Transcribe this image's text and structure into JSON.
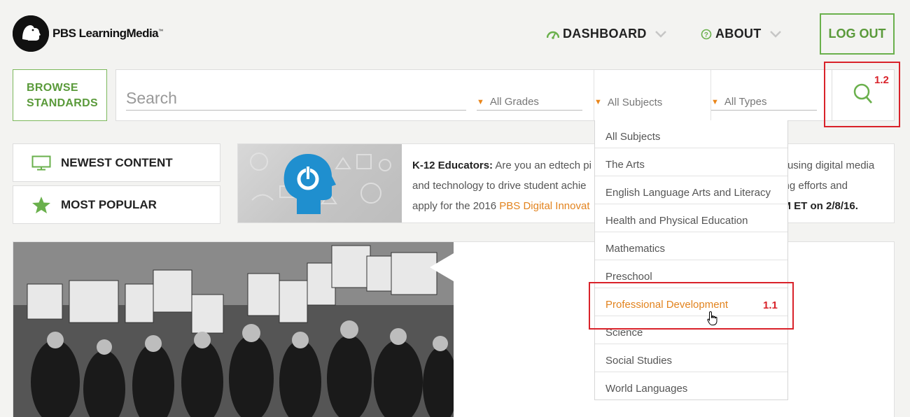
{
  "brand": {
    "name": "PBS LearningMedia",
    "trademark": "™"
  },
  "nav": {
    "dashboard": "DASHBOARD",
    "about": "ABOUT",
    "logout": "LOG OUT"
  },
  "search": {
    "browse_line1": "BROWSE",
    "browse_line2": "STANDARDS",
    "placeholder": "Search",
    "grades": "All Grades",
    "subjects": "All Subjects",
    "types": "All Types"
  },
  "annotations": {
    "search": "1.2",
    "dropdown": "1.1"
  },
  "sidebar": {
    "newest": "NEWEST CONTENT",
    "popular": "MOST POPULAR"
  },
  "promo": {
    "lead": "K-12 Educators:",
    "part1": " Are you an edtech pi",
    "part2": "using digital media",
    "part3": "and technology to drive student achie",
    "part4": "nding efforts and",
    "part5": "apply for the 2016 ",
    "link": "PBS Digital Innovat",
    "bold_end": "M ET on 2/8/16."
  },
  "subjects_dropdown": [
    "All Subjects",
    "The Arts",
    "English Language Arts and Literacy",
    "Health and Physical Education",
    "Mathematics",
    "Preschool",
    "Professional Development",
    "Science",
    "Social Studies",
    "World Languages"
  ],
  "colors": {
    "accent_green": "#6ab04c",
    "accent_orange": "#e2831e",
    "annotation_red": "#d9222a"
  }
}
